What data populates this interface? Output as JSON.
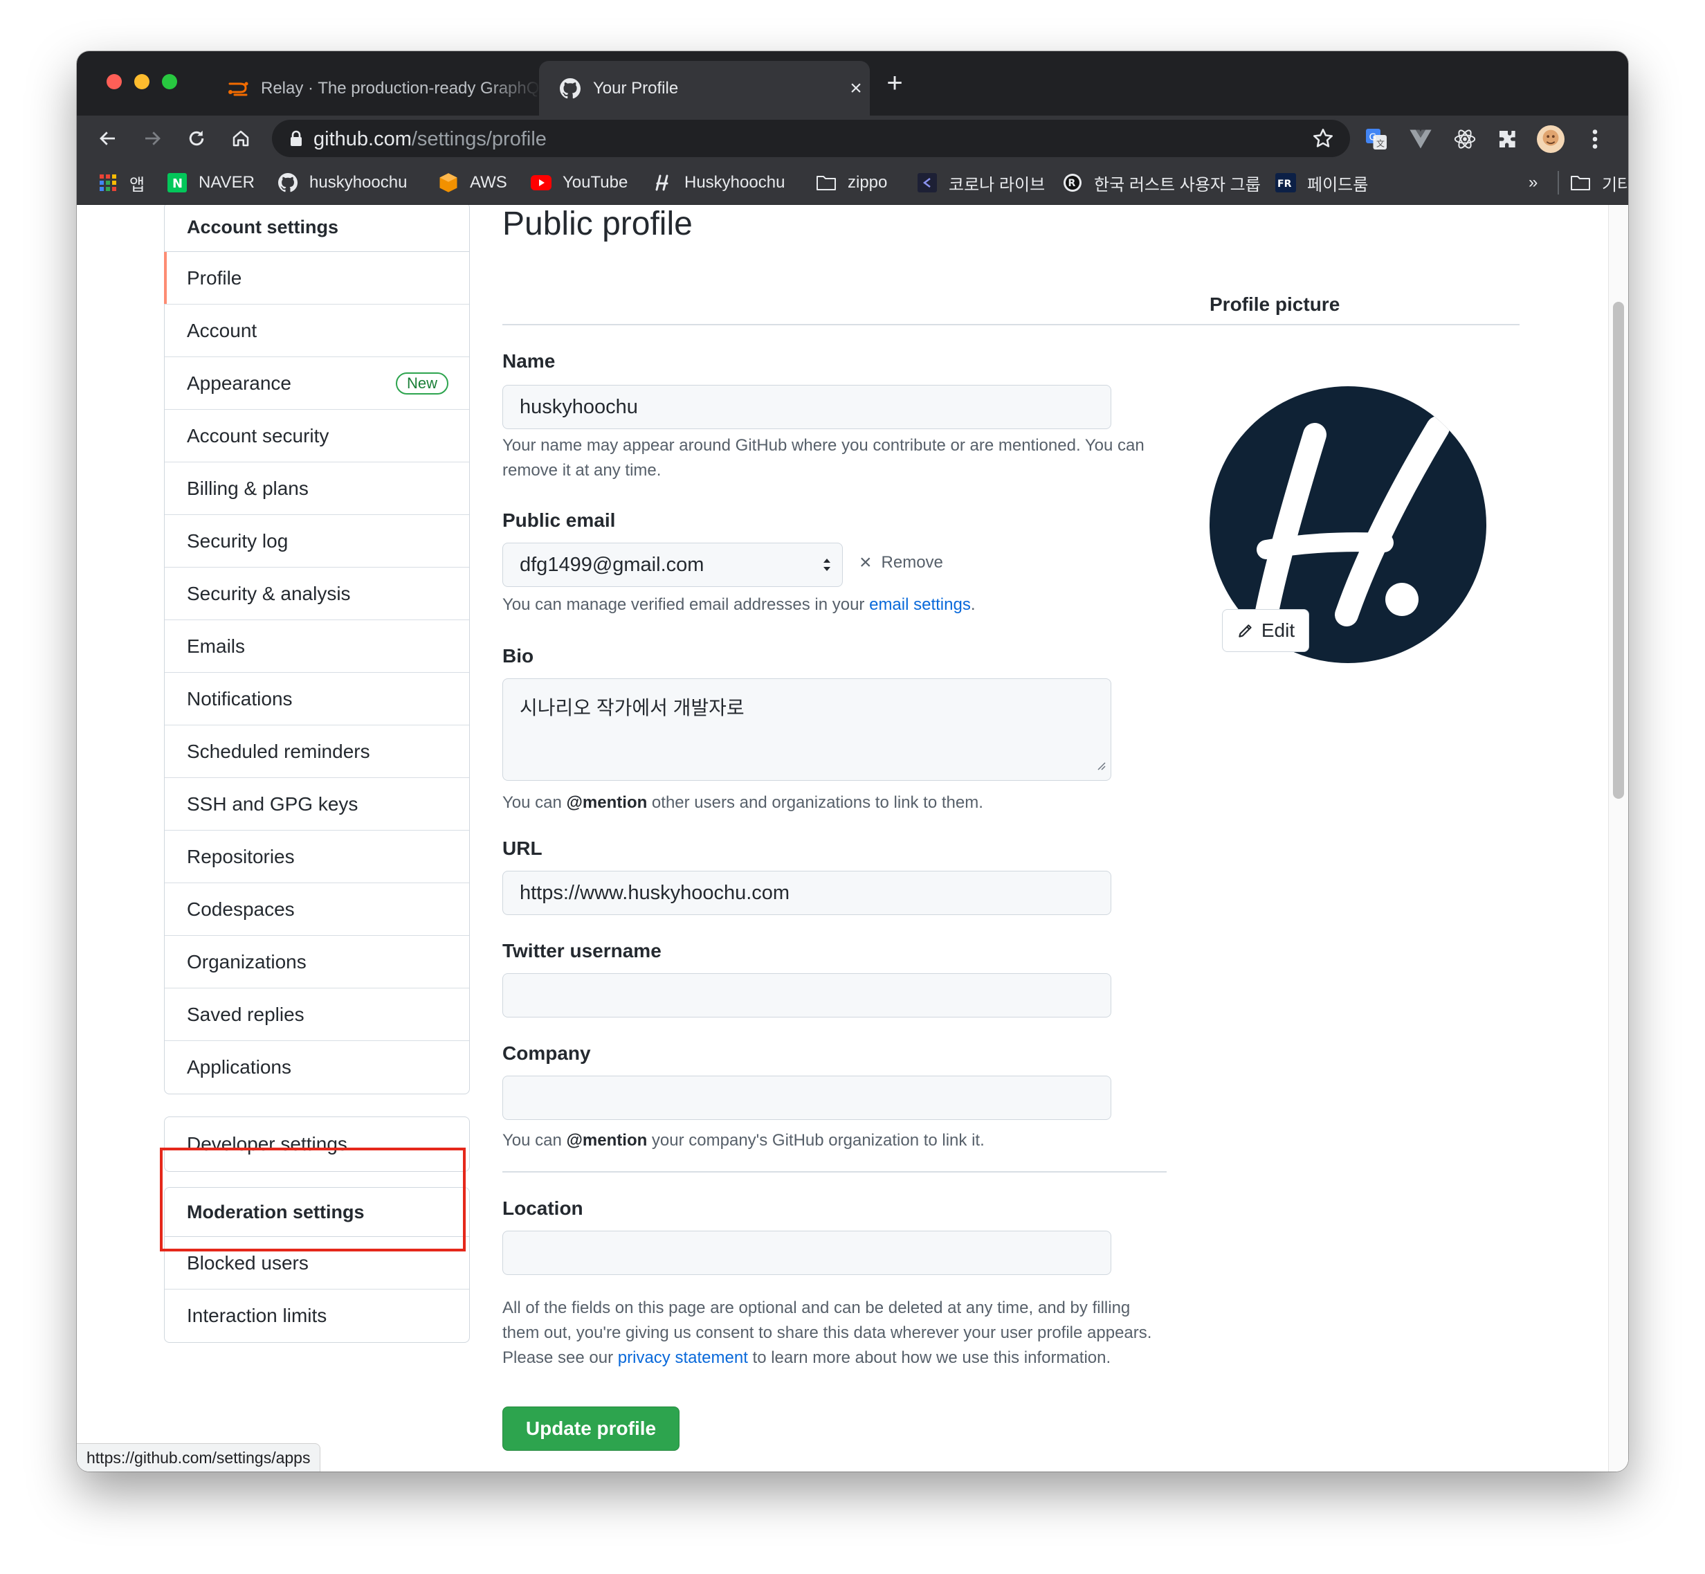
{
  "browser": {
    "tabs": [
      {
        "title": "Relay · The production-ready GraphQL client for React"
      },
      {
        "title": "Your Profile"
      }
    ],
    "address": {
      "domain": "github.com",
      "path": "/settings/profile"
    },
    "bookmarks": [
      {
        "label": "앱",
        "icon": "apps-grid-icon"
      },
      {
        "label": "NAVER",
        "icon": "naver-icon"
      },
      {
        "label": "huskyhoochu",
        "icon": "github-icon"
      },
      {
        "label": "AWS",
        "icon": "aws-icon"
      },
      {
        "label": "YouTube",
        "icon": "youtube-icon"
      },
      {
        "label": "Huskyhoochu",
        "icon": "huskyhoochu-icon"
      },
      {
        "label": "zippo",
        "icon": "folder-icon"
      },
      {
        "label": "코로나 라이브",
        "icon": "corona-live-icon"
      },
      {
        "label": "한국 러스트 사용자 그룹",
        "icon": "rust-icon"
      },
      {
        "label": "페이드룸",
        "icon": "fr-icon"
      }
    ],
    "bookmarks_overflow": "»",
    "other_bookmarks": "기타 북마크",
    "status_url": "https://github.com/settings/apps"
  },
  "sidebar": {
    "account_header": "Account settings",
    "items": [
      {
        "label": "Profile",
        "active": true
      },
      {
        "label": "Account"
      },
      {
        "label": "Appearance",
        "badge": "New"
      },
      {
        "label": "Account security"
      },
      {
        "label": "Billing & plans"
      },
      {
        "label": "Security log"
      },
      {
        "label": "Security & analysis"
      },
      {
        "label": "Emails"
      },
      {
        "label": "Notifications"
      },
      {
        "label": "Scheduled reminders"
      },
      {
        "label": "SSH and GPG keys"
      },
      {
        "label": "Repositories"
      },
      {
        "label": "Codespaces"
      },
      {
        "label": "Organizations"
      },
      {
        "label": "Saved replies"
      },
      {
        "label": "Applications"
      }
    ],
    "developer_settings": "Developer settings",
    "moderation_header": "Moderation settings",
    "moderation_items": [
      {
        "label": "Blocked users"
      },
      {
        "label": "Interaction limits"
      }
    ]
  },
  "main": {
    "title": "Public profile",
    "name": {
      "label": "Name",
      "value": "huskyhoochu",
      "note": "Your name may appear around GitHub where you contribute or are mentioned. You can remove it at any time."
    },
    "email": {
      "label": "Public email",
      "value": "dfg1499@gmail.com",
      "remove": "Remove",
      "note_pre": "You can manage verified email addresses in your ",
      "note_link": "email settings",
      "note_post": "."
    },
    "bio": {
      "label": "Bio",
      "value": "시나리오 작가에서 개발자로",
      "note_pre": "You can ",
      "note_mention": "@mention",
      "note_post": " other users and organizations to link to them."
    },
    "url": {
      "label": "URL",
      "value": "https://www.huskyhoochu.com"
    },
    "twitter": {
      "label": "Twitter username",
      "value": ""
    },
    "company": {
      "label": "Company",
      "value": "",
      "note_pre": "You can ",
      "note_mention": "@mention",
      "note_post": " your company's GitHub organization to link it."
    },
    "location": {
      "label": "Location",
      "value": ""
    },
    "footer": {
      "pre": "All of the fields on this page are optional and can be deleted at any time, and by filling them out, you're giving us consent to share this data wherever your user profile appears. Please see our ",
      "link": "privacy statement",
      "post": " to learn more about how we use this information."
    },
    "update_button": "Update profile",
    "picture": {
      "label": "Profile picture",
      "edit": "Edit"
    }
  },
  "colors": {
    "accent_green": "#2da44e",
    "link_blue": "#0969da",
    "active_marker": "#fd8c73",
    "highlight_red": "#e5281b",
    "avatar_bg": "#0f2235"
  }
}
